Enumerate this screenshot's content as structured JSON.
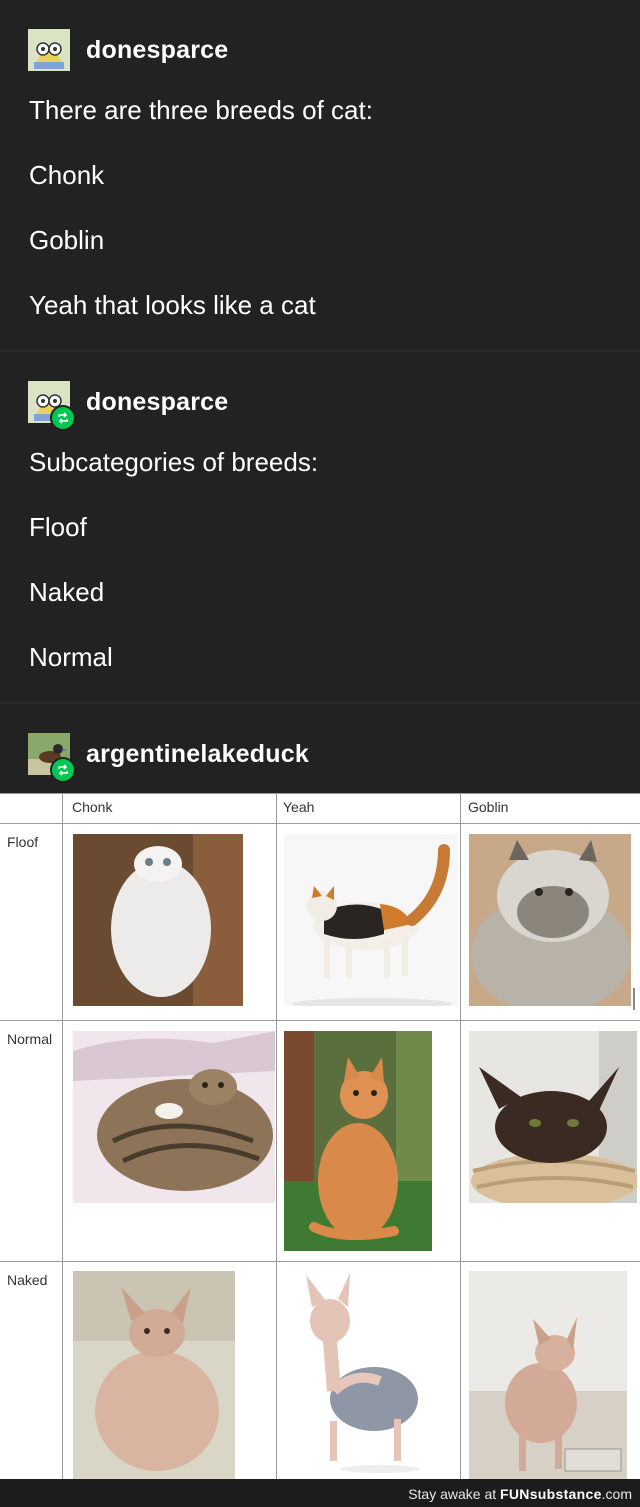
{
  "posts": [
    {
      "username": "donesparce",
      "lines": [
        "There are three breeds of cat:",
        "Chonk",
        "Goblin",
        "Yeah that looks like a cat"
      ]
    },
    {
      "username": "donesparce",
      "lines": [
        "Subcategories of breeds:",
        "Floof",
        "Naked",
        "Normal"
      ]
    },
    {
      "username": "argentinelakeduck"
    }
  ],
  "table": {
    "columns": [
      "Chonk",
      "Yeah",
      "Goblin"
    ],
    "rows": [
      "Floof",
      "Normal",
      "Naked"
    ]
  },
  "footer": {
    "prefix": "Stay awake at",
    "brand_fun": "FUN",
    "brand_substance": "substance",
    "domain": ".com"
  }
}
